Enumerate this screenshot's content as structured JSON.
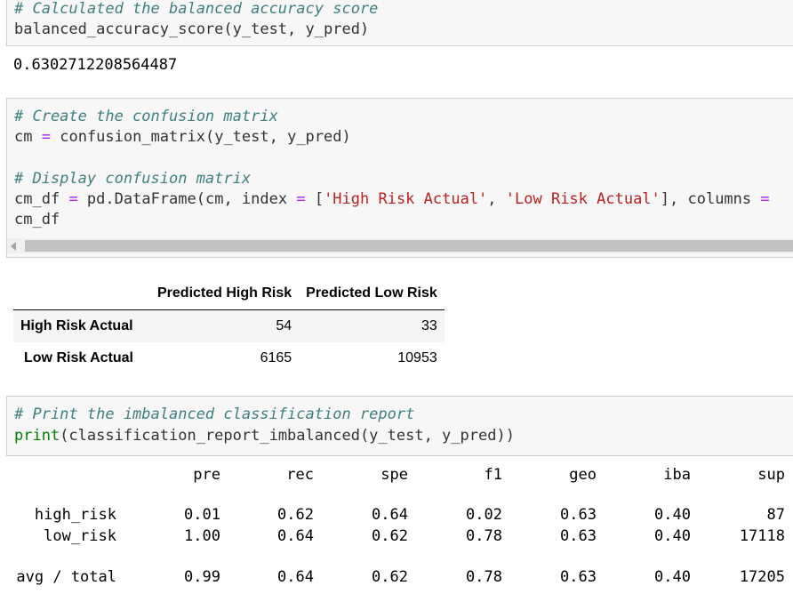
{
  "cell1": {
    "code_line1_comment": "# Calculated the balanced accuracy score",
    "code_line2": "balanced_accuracy_score(y_test, y_pred)",
    "output": "0.6302712208564487"
  },
  "cell2": {
    "comment1": "# Create the confusion matrix",
    "line2_var": "cm",
    "line2_op": "=",
    "line2_rest": " confusion_matrix(y_test, y_pred)",
    "comment2": "# Display confusion matrix",
    "line5_var": "cm_df",
    "line5_op": "=",
    "line5_a": " pd.DataFrame(cm, index ",
    "line5_op2": "=",
    "line5_b": " [",
    "line5_str1": "'High Risk Actual'",
    "line5_c": ", ",
    "line5_str2": "'Low Risk Actual'",
    "line5_d": "], columns ",
    "line5_op3": "=",
    "line6": "cm_df"
  },
  "dataframe": {
    "columns": [
      "Predicted High Risk",
      "Predicted Low Risk"
    ],
    "rows": [
      {
        "label": "High Risk Actual",
        "values": [
          "54",
          "33"
        ]
      },
      {
        "label": "Low Risk Actual",
        "values": [
          "6165",
          "10953"
        ]
      }
    ]
  },
  "cell3": {
    "comment": "# Print the imbalanced classification report",
    "func": "print",
    "rest": "(classification_report_imbalanced(y_test, y_pred))"
  },
  "report": {
    "headers": [
      "pre",
      "rec",
      "spe",
      "f1",
      "geo",
      "iba",
      "sup"
    ],
    "rows": [
      {
        "label": "high_risk",
        "values": [
          "0.01",
          "0.62",
          "0.64",
          "0.02",
          "0.63",
          "0.40",
          "87"
        ]
      },
      {
        "label": "low_risk",
        "values": [
          "1.00",
          "0.64",
          "0.62",
          "0.78",
          "0.63",
          "0.40",
          "17118"
        ]
      },
      {
        "label": "avg / total",
        "values": [
          "0.99",
          "0.64",
          "0.62",
          "0.78",
          "0.63",
          "0.40",
          "17205"
        ]
      }
    ]
  }
}
